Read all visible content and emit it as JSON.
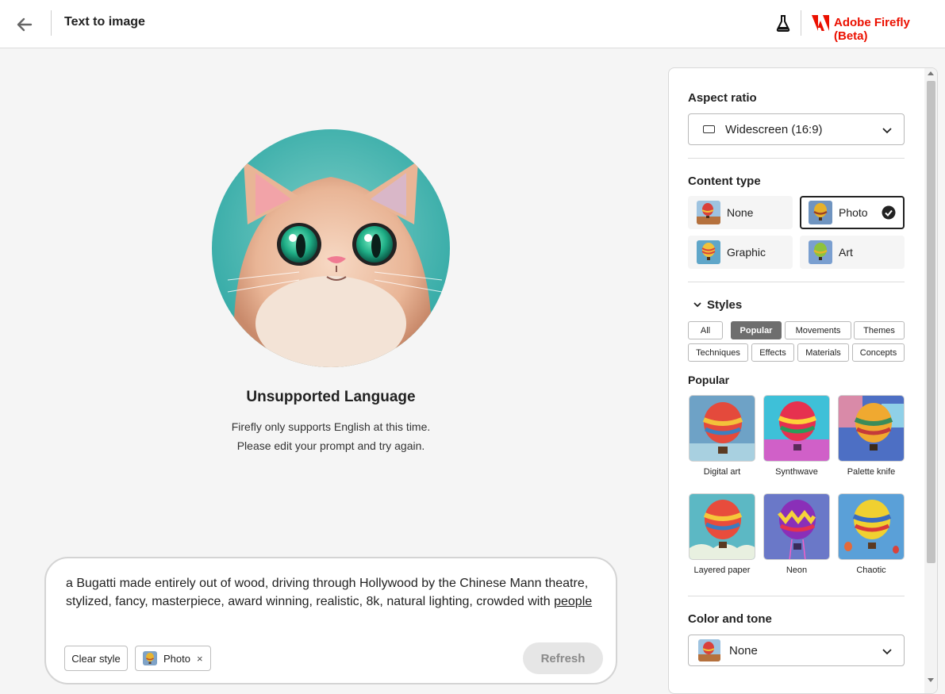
{
  "header": {
    "title": "Text to image",
    "brand": "Adobe Firefly (Beta)",
    "back_icon": "arrow-left-icon",
    "labs_icon": "flask-icon",
    "logo_icon": "adobe-logo-icon"
  },
  "result": {
    "title": "Unsupported Language",
    "line1": "Firefly only supports English at this time.",
    "line2": "Please edit your prompt and try again."
  },
  "prompt": {
    "text": "a Bugatti made entirely out of wood, driving through Hollywood by the Chinese Mann theatre, stylized, fancy, masterpiece, award winning, realistic, 8k, natural lighting, crowded with ",
    "underlined_word": "people",
    "clear_label": "Clear style",
    "chip_label": "Photo",
    "chip_remove": "×",
    "refresh_label": "Refresh"
  },
  "panel": {
    "aspect_ratio": {
      "title": "Aspect ratio",
      "value": "Widescreen (16:9)"
    },
    "content_type": {
      "title": "Content type",
      "options": [
        {
          "label": "None",
          "selected": false
        },
        {
          "label": "Photo",
          "selected": true
        },
        {
          "label": "Graphic",
          "selected": false
        },
        {
          "label": "Art",
          "selected": false
        }
      ]
    },
    "styles": {
      "title": "Styles",
      "tabs": [
        "All",
        "Popular",
        "Movements",
        "Themes",
        "Techniques",
        "Effects",
        "Materials",
        "Concepts"
      ],
      "active_tab": "Popular",
      "section_label": "Popular",
      "items": [
        {
          "label": "Digital art"
        },
        {
          "label": "Synthwave"
        },
        {
          "label": "Palette knife"
        },
        {
          "label": "Layered paper"
        },
        {
          "label": "Neon"
        },
        {
          "label": "Chaotic"
        }
      ]
    },
    "color_tone": {
      "title": "Color and tone",
      "value": "None"
    }
  },
  "colors": {
    "brand_red": "#eb1000",
    "active_tag": "#6e6e6e"
  }
}
